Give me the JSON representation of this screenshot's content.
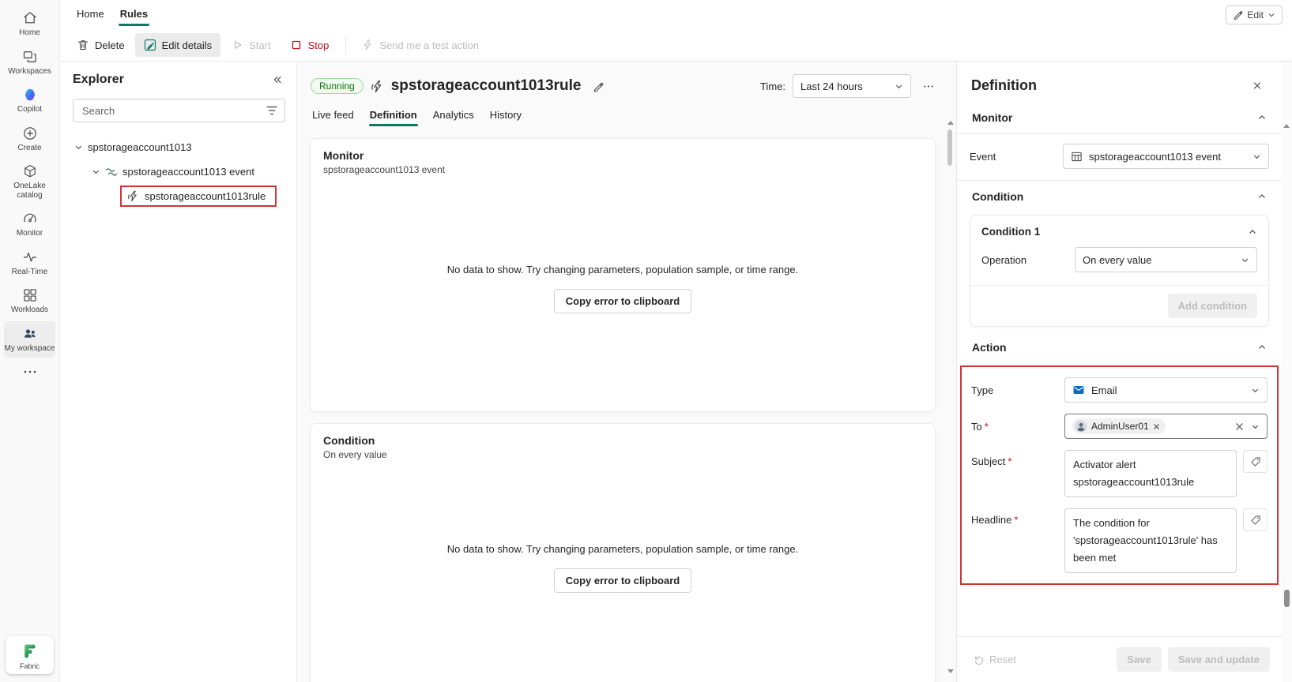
{
  "colors": {
    "accent": "#117865",
    "danger": "#C50F1F",
    "annotation": "#D13438",
    "running_bg": "#F1FAF1",
    "running_border": "#9FD89F",
    "running_text": "#0E700E"
  },
  "left_rail": {
    "items": [
      {
        "label": "Home",
        "icon": "home-icon"
      },
      {
        "label": "Workspaces",
        "icon": "workspaces-icon"
      },
      {
        "label": "Copilot",
        "icon": "copilot-icon"
      },
      {
        "label": "Create",
        "icon": "create-icon"
      },
      {
        "label": "OneLake catalog",
        "icon": "onelake-catalog-icon"
      },
      {
        "label": "Monitor",
        "icon": "monitor-icon"
      },
      {
        "label": "Real-Time",
        "icon": "real-time-icon"
      },
      {
        "label": "Workloads",
        "icon": "workloads-icon"
      },
      {
        "label": "My workspace",
        "icon": "my-workspace-icon",
        "selected": true
      }
    ],
    "more_icon": "more-ellipsis-icon",
    "logo_label": "Fabric"
  },
  "top_bar": {
    "tabs": [
      {
        "label": "Home",
        "active": false
      },
      {
        "label": "Rules",
        "active": true
      }
    ],
    "edit_button": "Edit"
  },
  "toolbar": {
    "buttons": [
      {
        "label": "Delete",
        "icon": "trash-icon"
      },
      {
        "label": "Edit details",
        "icon": "edit-details-icon",
        "toggled": true
      },
      {
        "label": "Start",
        "icon": "play-icon",
        "disabled": true
      },
      {
        "label": "Stop",
        "icon": "stop-icon",
        "danger": true
      },
      {
        "label": "Send me a test action",
        "icon": "test-action-icon",
        "disabled": true
      }
    ]
  },
  "explorer": {
    "title": "Explorer",
    "search_placeholder": "Search",
    "tree": [
      {
        "label": "spstorageaccount1013",
        "level": 0
      },
      {
        "label": "spstorageaccount1013 event",
        "level": 1,
        "icon": "event-stream-icon"
      },
      {
        "label": "spstorageaccount1013rule",
        "level": 2,
        "icon": "rule-icon",
        "highlighted": true
      }
    ]
  },
  "main": {
    "status": "Running",
    "title": "spstorageaccount1013rule",
    "time_label": "Time:",
    "time_value": "Last 24 hours",
    "tabs": [
      {
        "label": "Live feed"
      },
      {
        "label": "Definition",
        "active": true
      },
      {
        "label": "Analytics"
      },
      {
        "label": "History"
      }
    ],
    "empty_message": "No data to show. Try changing parameters, population sample, or time range.",
    "copy_button": "Copy error to clipboard",
    "cards": [
      {
        "title": "Monitor",
        "subtitle": "spstorageaccount1013 event"
      },
      {
        "title": "Condition",
        "subtitle": "On every value"
      }
    ]
  },
  "panel": {
    "title": "Definition",
    "monitor": {
      "header": "Monitor",
      "event_label": "Event",
      "event_value": "spstorageaccount1013 event"
    },
    "condition": {
      "header": "Condition",
      "card_title": "Condition 1",
      "operation_label": "Operation",
      "operation_value": "On every value",
      "add_button": "Add condition"
    },
    "action": {
      "header": "Action",
      "required_mark": "*",
      "type_label": "Type",
      "type_value": "Email",
      "to_label": "To",
      "to_chip": "AdminUser01",
      "subject_label": "Subject",
      "subject_value": "Activator alert spstorageaccount1013rule",
      "headline_label": "Headline",
      "headline_value": "The condition for 'spstorageaccount1013rule' has been met"
    },
    "footer": {
      "reset": "Reset",
      "save": "Save",
      "save_update": "Save and update"
    }
  }
}
